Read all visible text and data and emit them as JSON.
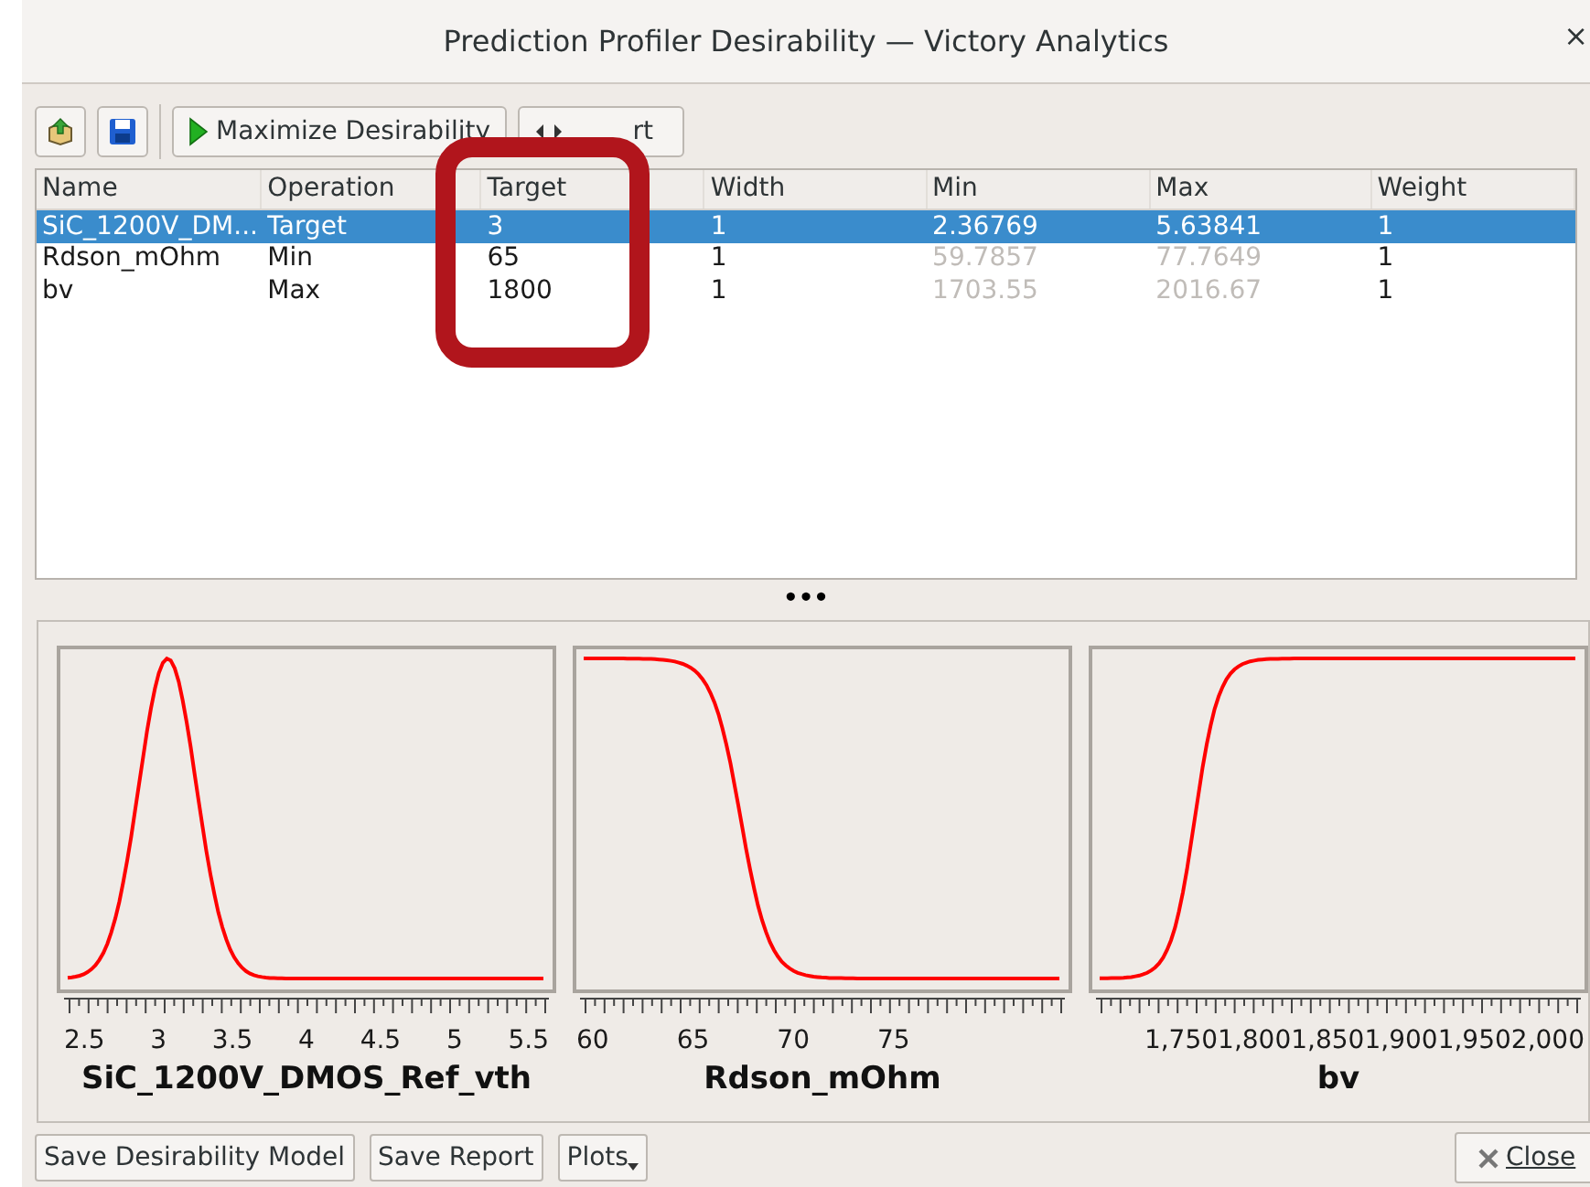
{
  "window": {
    "title": "Prediction Profiler Desirability — Victory Analytics",
    "close": "×"
  },
  "toolbar": {
    "buttons": [
      {
        "kind": "icon"
      },
      {
        "kind": "icon"
      },
      {
        "kind": "text",
        "label": "Maximize Desirability"
      },
      {
        "kind": "text",
        "label": "rt"
      }
    ]
  },
  "table": {
    "columns": [
      "Name",
      "Operation",
      "Target",
      "Width",
      "Min",
      "Max",
      "Weight"
    ],
    "rows": [
      {
        "selected": true,
        "range_disabled": true,
        "cells": [
          "SiC_1200V_DM...",
          "Target",
          "3",
          "1",
          "2.36769",
          "5.63841",
          "1"
        ]
      },
      {
        "selected": false,
        "range_disabled": true,
        "cells": [
          "Rdson_mOhm",
          "Min",
          "65",
          "1",
          "59.7857",
          "77.7649",
          "1"
        ]
      },
      {
        "selected": false,
        "range_disabled": true,
        "cells": [
          "bv",
          "Max",
          "1800",
          "1",
          "1703.55",
          "2016.67",
          "1"
        ]
      }
    ]
  },
  "splitter": "•••",
  "plots": [
    {
      "kind": "peak",
      "ticks": [
        "2.5",
        "3",
        "3.5",
        "4",
        "4.5",
        "5",
        "5.5"
      ],
      "label": "SiC_1200V_DMOS_Ref_vth"
    },
    {
      "kind": "falling",
      "ticks": [
        "60",
        "65",
        "70",
        "75"
      ],
      "label": "Rdson_mOhm"
    },
    {
      "kind": "rising",
      "ticks": [
        "1,750",
        "1,800",
        "1,850",
        "1,900",
        "1,950",
        "2,000"
      ],
      "label": "bv"
    }
  ],
  "annotation": {
    "kind": "rounded-frame"
  },
  "footer": {
    "buttons": [
      {
        "label": "Save Desirability Model"
      },
      {
        "label": "Save Report"
      },
      {
        "label": "Plots",
        "menu": true
      }
    ],
    "close": "Close"
  }
}
